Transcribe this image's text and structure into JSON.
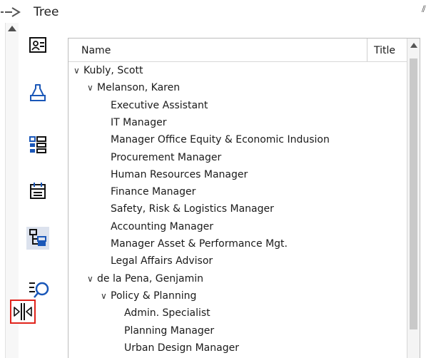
{
  "header": {
    "title": "Tree",
    "pin_glyph": "⫽"
  },
  "icons": {
    "contact": "contact-card-icon",
    "alert": "bell-icon",
    "list": "list-view-icon",
    "calendar": "calendar-icon",
    "tree": "org-tree-icon",
    "search": "list-search-icon",
    "resize": "resize-cursor-icon"
  },
  "columns": {
    "name": "Name",
    "title": "Title"
  },
  "rows": [
    {
      "label": "Kubly, Scott",
      "level": 0,
      "expanded": true
    },
    {
      "label": "Melanson, Karen",
      "level": 1,
      "expanded": true
    },
    {
      "label": "Executive Assistant",
      "level": 2
    },
    {
      "label": "IT Manager",
      "level": 2
    },
    {
      "label": "Manager Office Equity & Economic Indusion",
      "level": 2
    },
    {
      "label": "Procurement Manager",
      "level": 2
    },
    {
      "label": "Human Resources Manager",
      "level": 2
    },
    {
      "label": "Finance Manager",
      "level": 2
    },
    {
      "label": "Safety, Risk & Logistics Manager",
      "level": 2
    },
    {
      "label": "Accounting Manager",
      "level": 2
    },
    {
      "label": "Manager Asset & Performance Mgt.",
      "level": 2
    },
    {
      "label": "Legal Affairs Advisor",
      "level": 2
    },
    {
      "label": "de la Pena, Genjamin",
      "level": 1,
      "expanded": true
    },
    {
      "label": "Policy & Planning",
      "level": 2,
      "expanded": true
    },
    {
      "label": "Admin. Specialist",
      "level": 3
    },
    {
      "label": "Planning Manager",
      "level": 3
    },
    {
      "label": "Urban Design Manager",
      "level": 3
    }
  ],
  "colors": {
    "accent": "#1a57b8",
    "highlight": "#e0231b",
    "selected_bg": "#dce2ee"
  }
}
